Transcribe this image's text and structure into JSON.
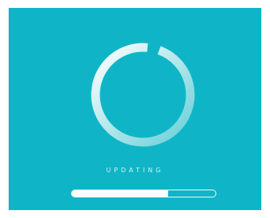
{
  "screen": {
    "background_color": "#0fb5c7"
  },
  "spinner": {
    "icon": "loading-ring-icon",
    "arc_fraction": 0.96,
    "gradient_start_color": "#ffffff",
    "gradient_end_color": "#66cfd8"
  },
  "status": {
    "label": "UPDATING"
  },
  "progress": {
    "value_fraction": 0.67,
    "color": "#ffffff"
  }
}
